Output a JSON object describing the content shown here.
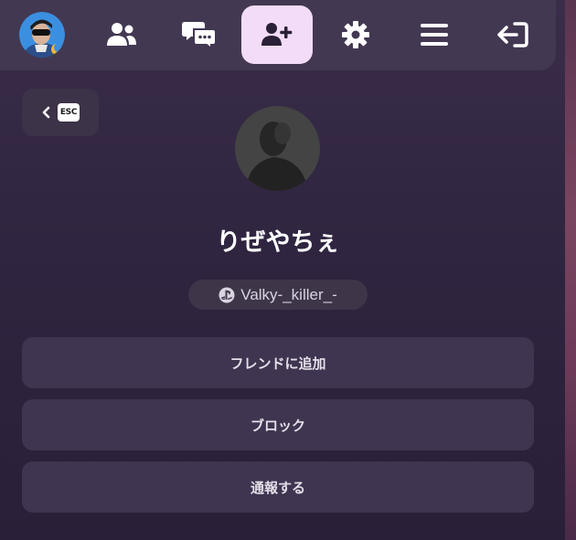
{
  "nav": {
    "items": [
      {
        "icon": "user-avatar"
      },
      {
        "icon": "friends-icon"
      },
      {
        "icon": "chat-icon"
      },
      {
        "icon": "add-friend-icon",
        "active": true
      },
      {
        "icon": "gear-icon"
      },
      {
        "icon": "menu-icon"
      },
      {
        "icon": "logout-icon"
      }
    ]
  },
  "back": {
    "key_label": "ESC",
    "icon": "chevron-left-icon"
  },
  "profile": {
    "display_name": "りぜやちぇ",
    "platform_icon": "playstation-icon",
    "platform_handle": "Valky-_killer_-"
  },
  "actions": {
    "add_friend": "フレンドに追加",
    "block": "ブロック",
    "report": "通報する"
  },
  "colors": {
    "panel": "#2f2540",
    "topbar": "#433852",
    "active_tab": "#f3dcf7",
    "button": "#3f3550"
  }
}
